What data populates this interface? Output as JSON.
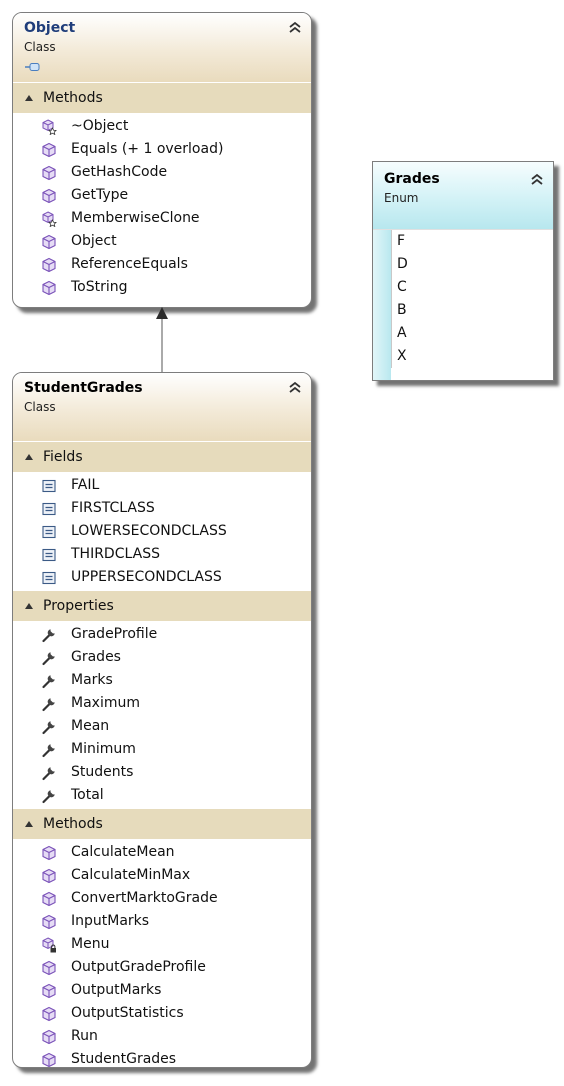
{
  "object_class": {
    "name": "Object",
    "kind": "Class",
    "sections": [
      {
        "title": "Methods",
        "items": [
          {
            "label": "~Object",
            "icon": "method-protected-icon"
          },
          {
            "label": "Equals (+ 1 overload)",
            "icon": "method-icon"
          },
          {
            "label": "GetHashCode",
            "icon": "method-icon"
          },
          {
            "label": "GetType",
            "icon": "method-icon"
          },
          {
            "label": "MemberwiseClone",
            "icon": "method-protected-icon"
          },
          {
            "label": "Object",
            "icon": "method-icon"
          },
          {
            "label": "ReferenceEquals",
            "icon": "method-icon"
          },
          {
            "label": "ToString",
            "icon": "method-icon"
          }
        ]
      }
    ]
  },
  "grades_enum": {
    "name": "Grades",
    "kind": "Enum",
    "values": [
      "F",
      "D",
      "C",
      "B",
      "A",
      "X"
    ]
  },
  "studentgrades_class": {
    "name": "StudentGrades",
    "kind": "Class",
    "sections": [
      {
        "title": "Fields",
        "items": [
          {
            "label": "FAIL",
            "icon": "field-icon"
          },
          {
            "label": "FIRSTCLASS",
            "icon": "field-icon"
          },
          {
            "label": "LOWERSECONDCLASS",
            "icon": "field-icon"
          },
          {
            "label": "THIRDCLASS",
            "icon": "field-icon"
          },
          {
            "label": "UPPERSECONDCLASS",
            "icon": "field-icon"
          }
        ]
      },
      {
        "title": "Properties",
        "items": [
          {
            "label": "GradeProfile",
            "icon": "property-icon"
          },
          {
            "label": "Grades",
            "icon": "property-icon"
          },
          {
            "label": "Marks",
            "icon": "property-icon"
          },
          {
            "label": "Maximum",
            "icon": "property-icon"
          },
          {
            "label": "Mean",
            "icon": "property-icon"
          },
          {
            "label": "Minimum",
            "icon": "property-icon"
          },
          {
            "label": "Students",
            "icon": "property-icon"
          },
          {
            "label": "Total",
            "icon": "property-icon"
          }
        ]
      },
      {
        "title": "Methods",
        "items": [
          {
            "label": "CalculateMean",
            "icon": "method-icon"
          },
          {
            "label": "CalculateMinMax",
            "icon": "method-icon"
          },
          {
            "label": "ConvertMarktoGrade",
            "icon": "method-icon"
          },
          {
            "label": "InputMarks",
            "icon": "method-icon"
          },
          {
            "label": "Menu",
            "icon": "method-private-icon"
          },
          {
            "label": "OutputGradeProfile",
            "icon": "method-icon"
          },
          {
            "label": "OutputMarks",
            "icon": "method-icon"
          },
          {
            "label": "OutputStatistics",
            "icon": "method-icon"
          },
          {
            "label": "Run",
            "icon": "method-icon"
          },
          {
            "label": "StudentGrades",
            "icon": "method-icon"
          }
        ]
      }
    ]
  },
  "colors": {
    "class_header": "#e9dbbd",
    "section_header": "#e6dbbc",
    "enum_header": "#b7e7ee",
    "method_icon": "#8a5cc4",
    "title_link": "#1f3d7a"
  }
}
